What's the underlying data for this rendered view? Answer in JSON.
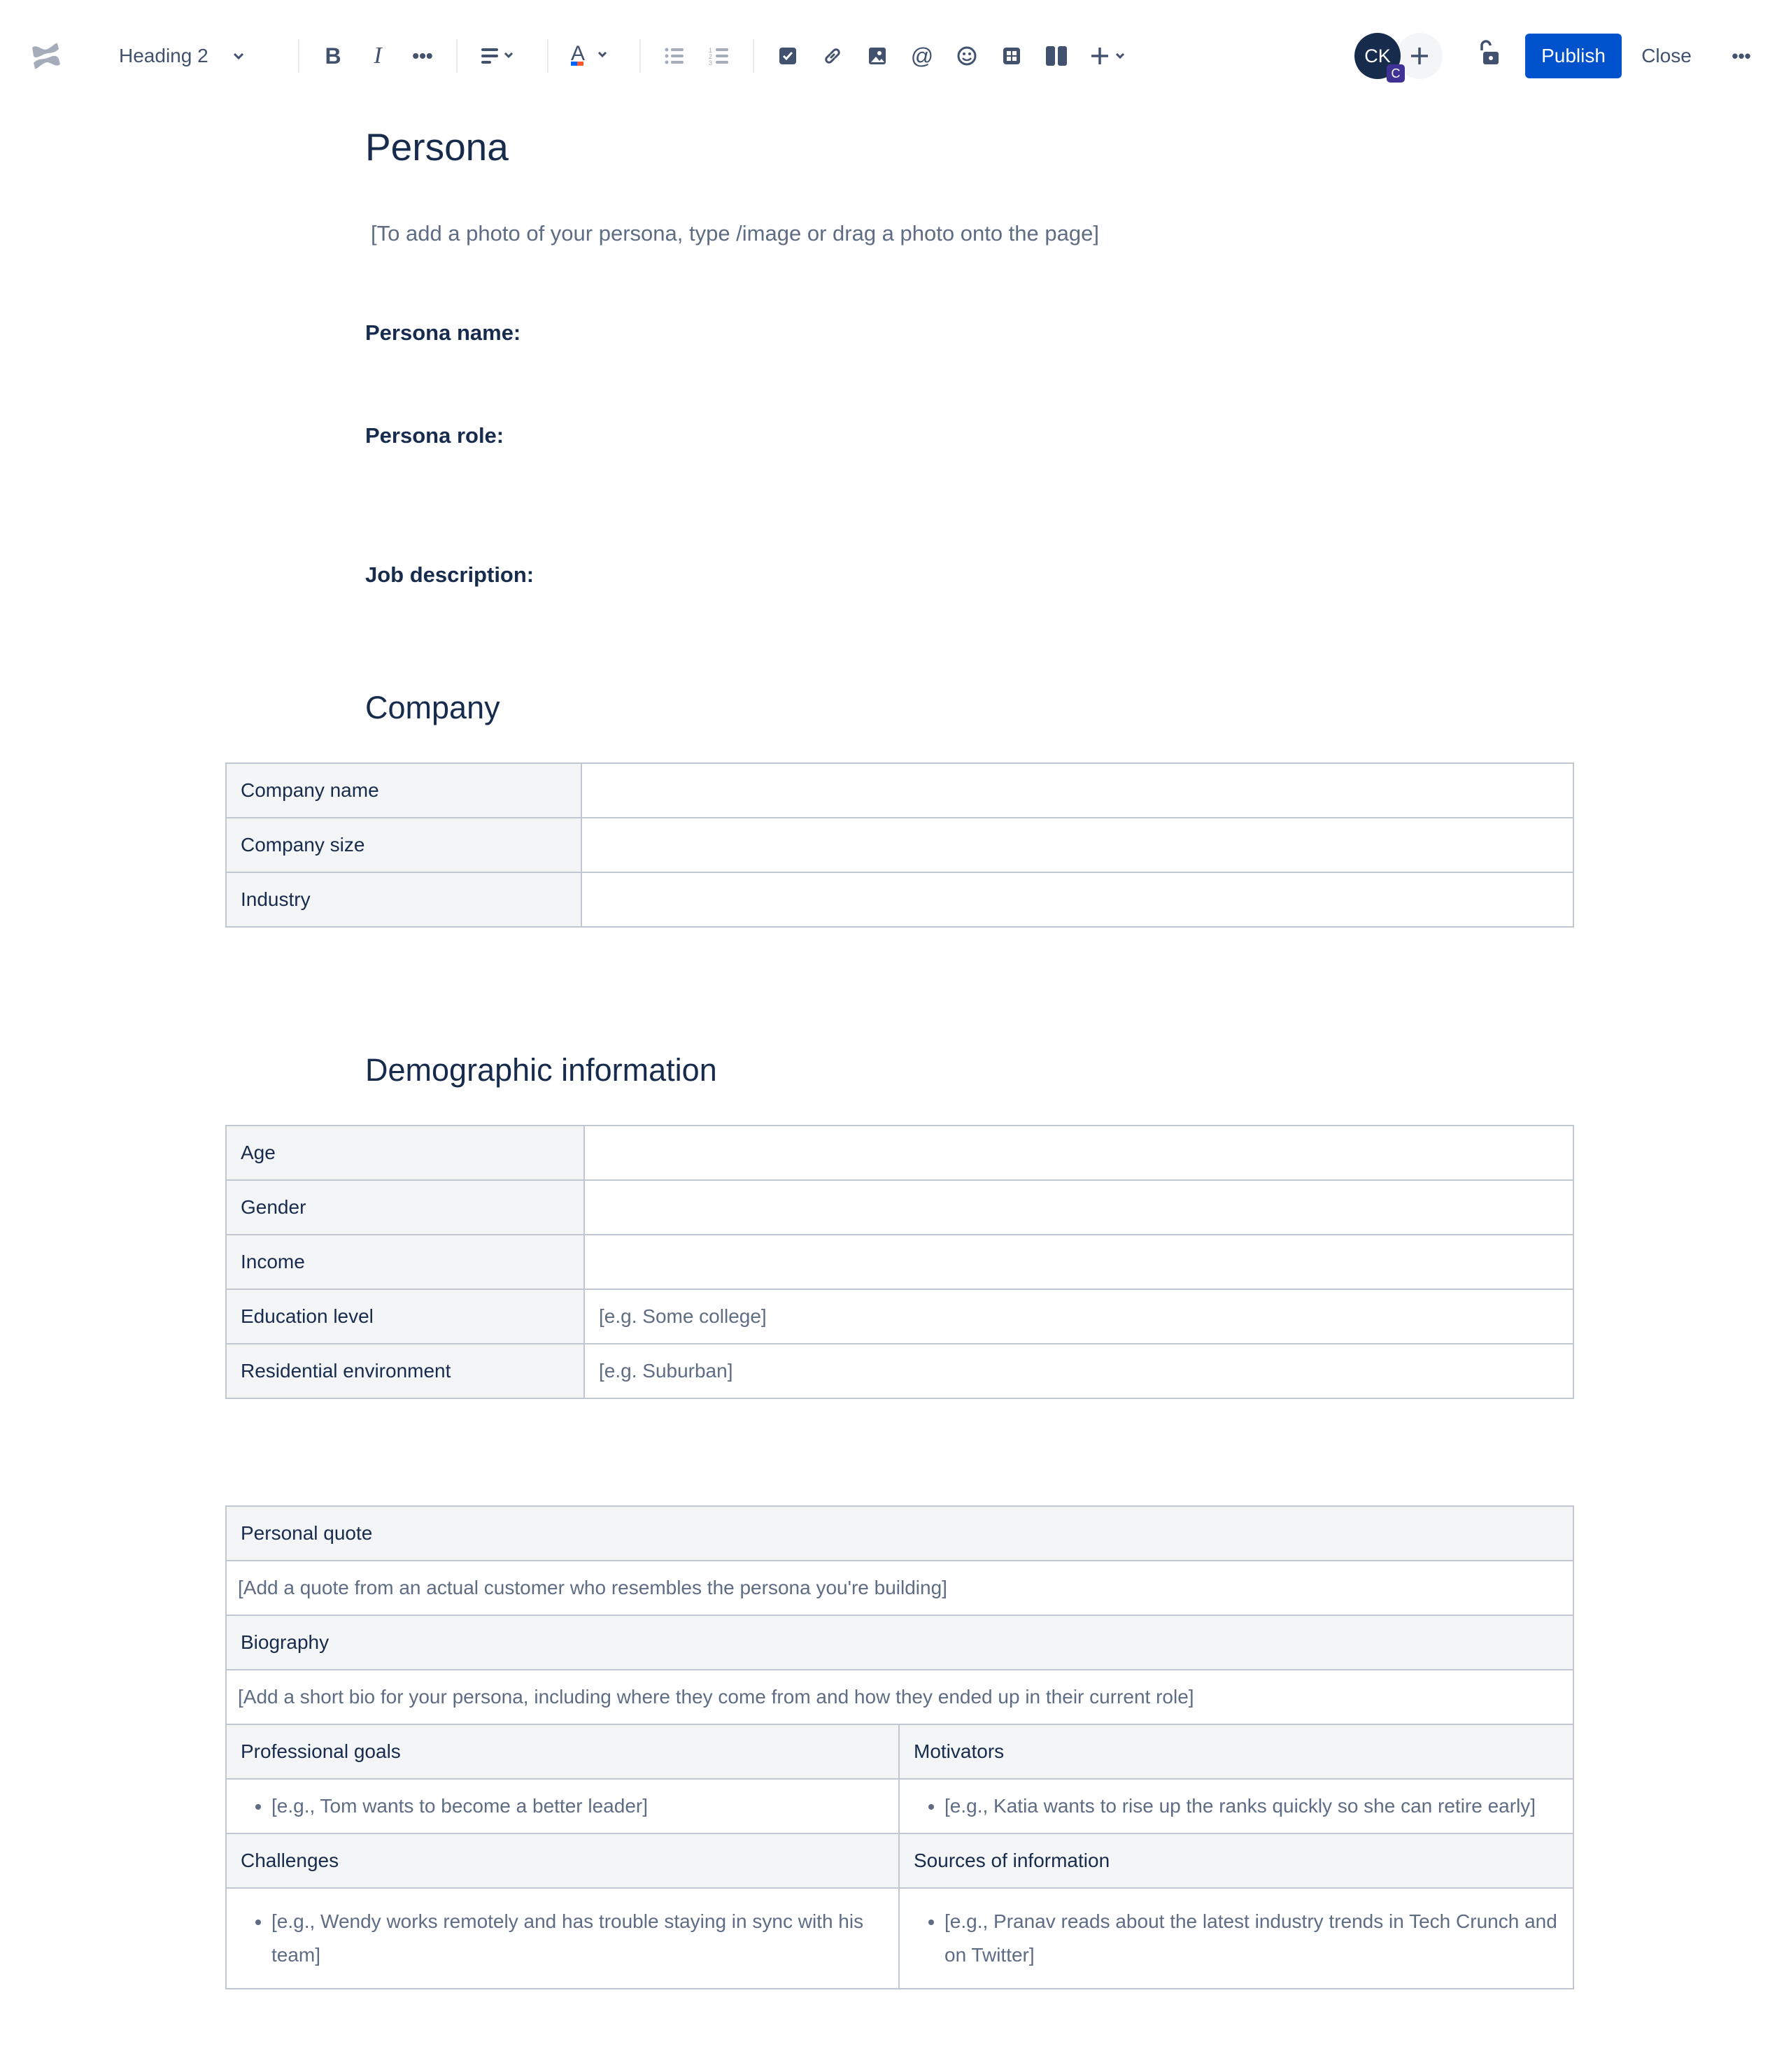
{
  "toolbar": {
    "logo": "confluence-logo",
    "text_style": "Heading 2",
    "icons": [
      "bold-icon",
      "italic-icon",
      "more-formatting-icon",
      "align-icon",
      "text-color-icon",
      "bullet-list-icon",
      "numbered-list-icon",
      "action-item-icon",
      "link-icon",
      "image-icon",
      "mention-icon",
      "emoji-icon",
      "table-icon",
      "layouts-icon",
      "insert-plus-icon"
    ],
    "avatar_initials": "CK",
    "avatar_badge": "C",
    "publish_label": "Publish",
    "close_label": "Close"
  },
  "page": {
    "title": "Persona",
    "photo_placeholder": "[To add a photo of your persona, type /image or drag a photo onto the page]",
    "persona_name_label": "Persona name:",
    "persona_role_label": "Persona role:",
    "job_description_label": "Job description:",
    "company_heading": "Company",
    "company_table": [
      {
        "label": "Company name",
        "value": ""
      },
      {
        "label": "Company size",
        "value": ""
      },
      {
        "label": "Industry",
        "value": ""
      }
    ],
    "demographic_heading": "Demographic information",
    "demographic_table": [
      {
        "label": "Age",
        "value": ""
      },
      {
        "label": "Gender",
        "value": ""
      },
      {
        "label": "Income",
        "value": ""
      },
      {
        "label": "Education level",
        "value": "[e.g. Some college]"
      },
      {
        "label": "Residential environment",
        "value": "[e.g. Suburban]"
      }
    ],
    "profile_table": {
      "personal_quote_label": "Personal quote",
      "personal_quote_placeholder": "[Add a quote from an actual customer who resembles the persona you're building]",
      "biography_label": "Biography",
      "biography_placeholder": "[Add a short bio for your persona, including where they come from and how they ended up in their current role]",
      "professional_goals_label": "Professional goals",
      "professional_goals_item": "[e.g., Tom wants to become a better leader]",
      "motivators_label": "Motivators",
      "motivators_item": "[e.g., Katia wants to rise up the ranks quickly so she can retire early]",
      "challenges_label": "Challenges",
      "challenges_item": "[e.g., Wendy works remotely and has trouble staying in sync with his team]",
      "sources_label": "Sources of information",
      "sources_item": "[e.g., Pranav reads about the latest industry trends in Tech Crunch and on Twitter]"
    }
  }
}
